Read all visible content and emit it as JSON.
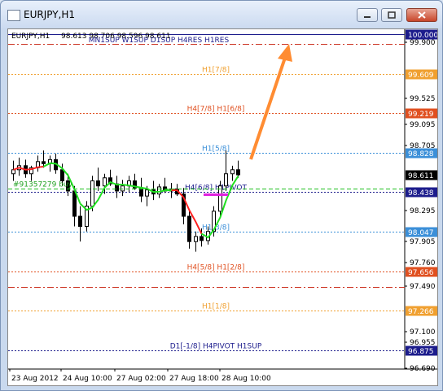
{
  "window": {
    "title": "EURJPY,H1"
  },
  "chart_info": {
    "symbol_tf": "EURJPY,H1",
    "ohlc": "98.613 98.706 98.596 98.611",
    "top_label": "MN1SUP W1SUP D1SUP H4RES H1RES"
  },
  "trade_label": "#91357279 buy",
  "colors": {
    "background": "#ffffff",
    "bull": "#000000",
    "current_price_box": "#000000",
    "blue_line": "#1e90ff",
    "arrow": "#ff8c32"
  },
  "levels": [
    {
      "price": 100.0,
      "label": "",
      "tag": "100.000",
      "color": "#1c1c8c",
      "dash": "solid",
      "tagbg": "#1c1c8c"
    },
    {
      "price": 99.9,
      "label": "",
      "tag": "",
      "color": "#cc3322",
      "dash": "dashdot"
    },
    {
      "price": 99.609,
      "label": "H1[7/8]",
      "tag": "99.609",
      "color": "#f0a030",
      "dash": "dot",
      "tagbg": "#f0a030"
    },
    {
      "price": 99.219,
      "label": "H4[7/8] H1[6/8]",
      "tag": "99.219",
      "color": "#e05020",
      "dash": "dot",
      "tagbg": "#e05020"
    },
    {
      "price": 98.828,
      "label": "H1[5/8]",
      "tag": "98.828",
      "color": "#3b8fd8",
      "dash": "dot",
      "tagbg": "#3b8fd8"
    },
    {
      "price": 98.438,
      "label": "H4[6/8] H1PIVOT",
      "tag": "98.438",
      "color": "#1c1c8c",
      "dash": "dot",
      "tagbg": "#1c1c8c"
    },
    {
      "price": 98.047,
      "label": "H1[3/8]",
      "tag": "98.047",
      "color": "#3b8fd8",
      "dash": "dot",
      "tagbg": "#3b8fd8"
    },
    {
      "price": 97.656,
      "label": "H4[5/8] H1[2/8]",
      "tag": "97.656",
      "color": "#e05020",
      "dash": "dot",
      "tagbg": "#e05020"
    },
    {
      "price": 97.5,
      "label": "",
      "tag": "",
      "color": "#cc3322",
      "dash": "dashdot"
    },
    {
      "price": 97.266,
      "label": "H1[1/8]",
      "tag": "97.266",
      "color": "#f0a030",
      "dash": "dot",
      "tagbg": "#f0a030"
    },
    {
      "price": 96.875,
      "label": "D1[-1/8] H4PIVOT H1SUP",
      "tag": "96.875",
      "color": "#1c1c8c",
      "dash": "dot",
      "tagbg": "#1c1c8c"
    }
  ],
  "price_ticks": [
    "99.900",
    "99.525",
    "99.095",
    "98.705",
    "98.295",
    "97.905",
    "97.760",
    "97.490",
    "97.100",
    "96.955",
    "96.690"
  ],
  "current_price": "98.611",
  "time_ticks": [
    "23 Aug 2012",
    "24 Aug 10:00",
    "27 Aug 02:00",
    "27 Aug 18:00",
    "28 Aug 10:00"
  ],
  "chart_data": {
    "type": "candlestick",
    "title": "EURJPY,H1",
    "candles": [
      {
        "o": 98.62,
        "h": 98.75,
        "l": 98.55,
        "c": 98.66
      },
      {
        "o": 98.66,
        "h": 98.78,
        "l": 98.6,
        "c": 98.7
      },
      {
        "o": 98.7,
        "h": 98.76,
        "l": 98.58,
        "c": 98.62
      },
      {
        "o": 98.62,
        "h": 98.7,
        "l": 98.55,
        "c": 98.68
      },
      {
        "o": 98.68,
        "h": 98.8,
        "l": 98.64,
        "c": 98.74
      },
      {
        "o": 98.74,
        "h": 98.85,
        "l": 98.68,
        "c": 98.72
      },
      {
        "o": 98.72,
        "h": 98.8,
        "l": 98.64,
        "c": 98.76
      },
      {
        "o": 98.76,
        "h": 98.82,
        "l": 98.62,
        "c": 98.66
      },
      {
        "o": 98.66,
        "h": 98.72,
        "l": 98.5,
        "c": 98.55
      },
      {
        "o": 98.55,
        "h": 98.62,
        "l": 98.4,
        "c": 98.45
      },
      {
        "o": 98.45,
        "h": 98.5,
        "l": 98.1,
        "c": 98.2
      },
      {
        "o": 98.2,
        "h": 98.3,
        "l": 97.95,
        "c": 98.1
      },
      {
        "o": 98.1,
        "h": 98.35,
        "l": 98.05,
        "c": 98.3
      },
      {
        "o": 98.3,
        "h": 98.6,
        "l": 98.25,
        "c": 98.55
      },
      {
        "o": 98.55,
        "h": 98.68,
        "l": 98.45,
        "c": 98.5
      },
      {
        "o": 98.5,
        "h": 98.62,
        "l": 98.42,
        "c": 98.58
      },
      {
        "o": 98.58,
        "h": 98.66,
        "l": 98.5,
        "c": 98.52
      },
      {
        "o": 98.52,
        "h": 98.6,
        "l": 98.38,
        "c": 98.45
      },
      {
        "o": 98.45,
        "h": 98.56,
        "l": 98.4,
        "c": 98.5
      },
      {
        "o": 98.5,
        "h": 98.6,
        "l": 98.44,
        "c": 98.55
      },
      {
        "o": 98.55,
        "h": 98.62,
        "l": 98.46,
        "c": 98.48
      },
      {
        "o": 98.48,
        "h": 98.58,
        "l": 98.34,
        "c": 98.4
      },
      {
        "o": 98.4,
        "h": 98.5,
        "l": 98.3,
        "c": 98.46
      },
      {
        "o": 98.46,
        "h": 98.55,
        "l": 98.36,
        "c": 98.42
      },
      {
        "o": 98.42,
        "h": 98.52,
        "l": 98.38,
        "c": 98.49
      },
      {
        "o": 98.49,
        "h": 98.58,
        "l": 98.43,
        "c": 98.45
      },
      {
        "o": 98.45,
        "h": 98.53,
        "l": 98.38,
        "c": 98.47
      },
      {
        "o": 98.47,
        "h": 98.52,
        "l": 98.4,
        "c": 98.42
      },
      {
        "o": 98.42,
        "h": 98.48,
        "l": 98.12,
        "c": 98.2
      },
      {
        "o": 98.2,
        "h": 98.25,
        "l": 97.88,
        "c": 97.95
      },
      {
        "o": 97.95,
        "h": 98.05,
        "l": 97.85,
        "c": 98.0
      },
      {
        "o": 98.0,
        "h": 98.08,
        "l": 97.9,
        "c": 97.96
      },
      {
        "o": 97.96,
        "h": 98.1,
        "l": 97.92,
        "c": 98.05
      },
      {
        "o": 98.05,
        "h": 98.3,
        "l": 98.0,
        "c": 98.25
      },
      {
        "o": 98.25,
        "h": 98.55,
        "l": 98.2,
        "c": 98.5
      },
      {
        "o": 98.5,
        "h": 98.85,
        "l": 98.45,
        "c": 98.62
      },
      {
        "o": 98.62,
        "h": 98.7,
        "l": 98.55,
        "c": 98.66
      },
      {
        "o": 98.66,
        "h": 98.75,
        "l": 98.58,
        "c": 98.61
      }
    ],
    "ylim": [
      96.69,
      100.0
    ],
    "xlabel": "",
    "ylabel": ""
  }
}
